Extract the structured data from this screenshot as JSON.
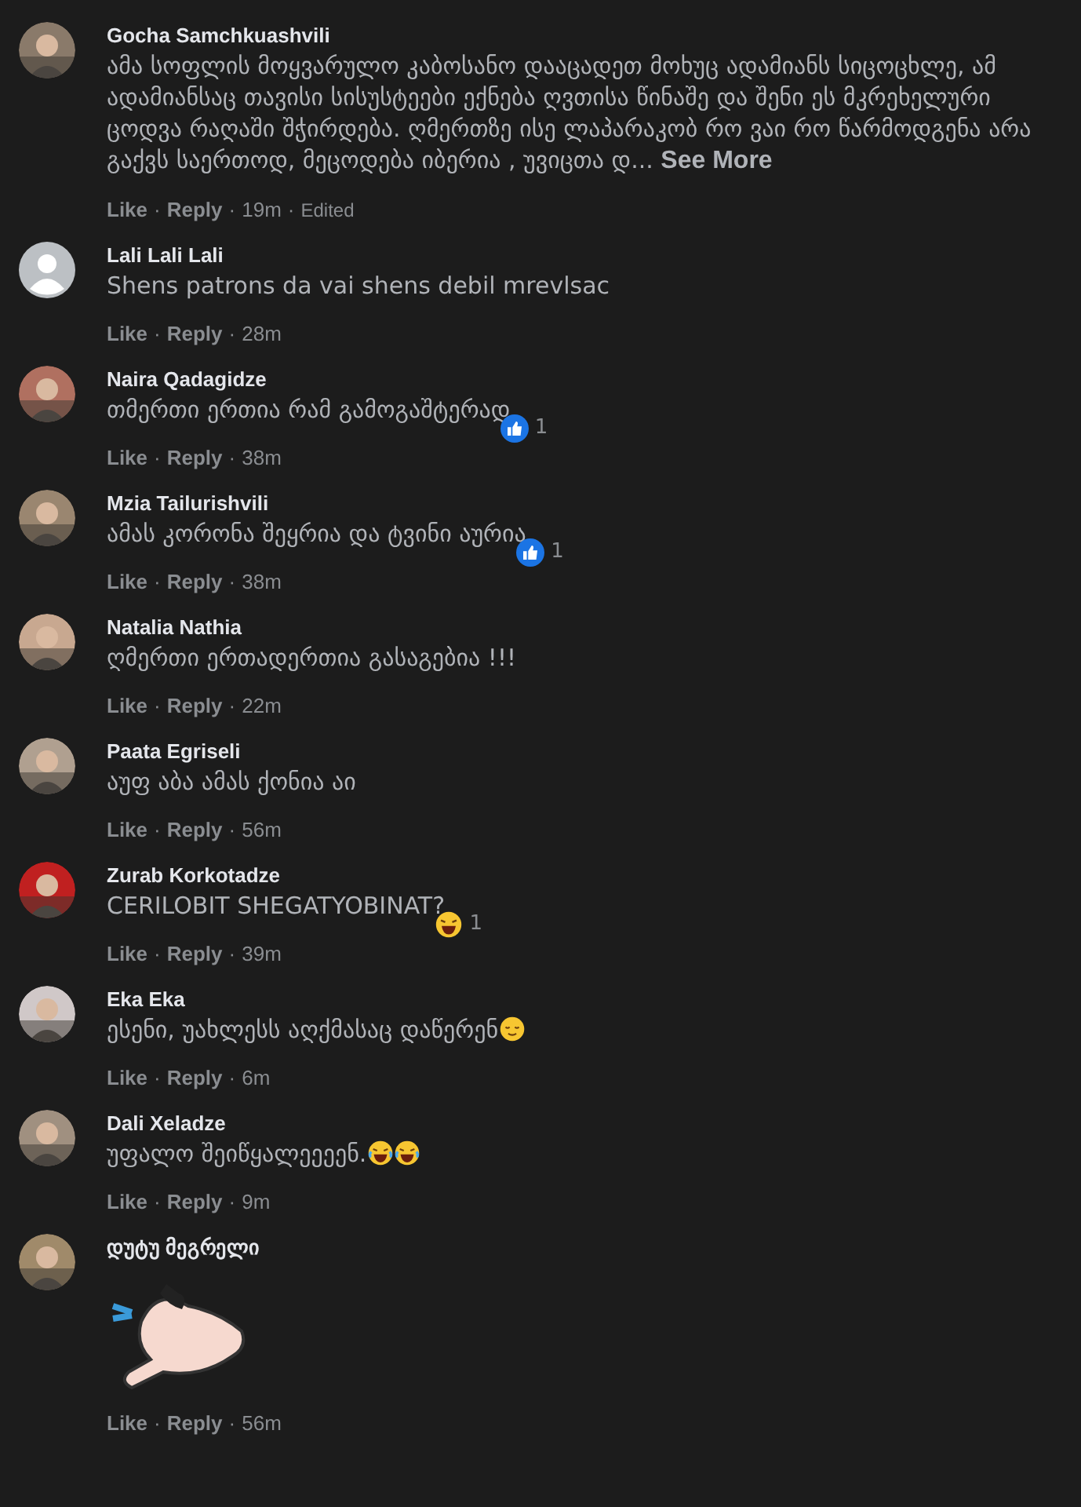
{
  "comments": [
    {
      "author": "Gocha Samchkuashvili",
      "avatar": {
        "kind": "picture"
      },
      "text": "ამა სოფლის მოყვარულო კაბოსანო დააცადეთ მოხუც ადამიანს სიცოცხლე, ამ ადამიანსაც თავისი სისუსტეები ექნება ღვთისა წინაშე და შენი ეს მკრეხელური ცოდვა რაღაში შჭირდება. ღმერთზე ისე ლაპარაკობ რო ვაი რო წარმოდგენა არა გაქვს საერთოდ, მეცოდება იბერია , უვიცთა დ...",
      "see_more": "See More",
      "actions": {
        "like": "Like",
        "separator": "·",
        "reply": "Reply",
        "time": "19m",
        "edited": "Edited"
      }
    },
    {
      "author": "Lali Lali Lali",
      "avatar": {
        "kind": "default"
      },
      "text": "Shens patrons da vai shens debil mrevlsac",
      "actions": {
        "like": "Like",
        "separator": "·",
        "reply": "Reply",
        "time": "28m"
      }
    },
    {
      "author": "Naira Qadagidze",
      "avatar": {
        "kind": "picture"
      },
      "text": "თმერთი ერთია რამ გამოგაშტერად",
      "reaction": {
        "kind": "like",
        "count": "1"
      },
      "actions": {
        "like": "Like",
        "separator": "·",
        "reply": "Reply",
        "time": "38m"
      }
    },
    {
      "author": "Mzia Tailurishvili",
      "avatar": {
        "kind": "picture"
      },
      "text": "ამას კორონა შეყრია და ტვინი აურია",
      "reaction": {
        "kind": "like",
        "count": "1"
      },
      "actions": {
        "like": "Like",
        "separator": "·",
        "reply": "Reply",
        "time": "38m"
      }
    },
    {
      "author": "Natalia Nathia",
      "avatar": {
        "kind": "picture"
      },
      "text": "ღმერთი ერთადერთია გასაგებია !!!",
      "actions": {
        "like": "Like",
        "separator": "·",
        "reply": "Reply",
        "time": "22m"
      }
    },
    {
      "author": "Paata Egriseli",
      "avatar": {
        "kind": "picture"
      },
      "text": "აუფ აბა ამას ქონია აი",
      "actions": {
        "like": "Like",
        "separator": "·",
        "reply": "Reply",
        "time": "56m"
      }
    },
    {
      "author": "Zurab Korkotadze",
      "avatar": {
        "kind": "picture"
      },
      "text": "CERILOBIT SHEGATYOBINAT?",
      "reaction": {
        "kind": "haha",
        "count": "1"
      },
      "actions": {
        "like": "Like",
        "separator": "·",
        "reply": "Reply",
        "time": "39m"
      }
    },
    {
      "author": "Eka Eka",
      "avatar": {
        "kind": "picture"
      },
      "text": "ესენი, უახლესს აღქმასაც დაწერენ",
      "emojis": [
        {
          "kind": "relieved"
        }
      ],
      "actions": {
        "like": "Like",
        "separator": "·",
        "reply": "Reply",
        "time": "6m"
      }
    },
    {
      "author": "Dali Xeladze",
      "avatar": {
        "kind": "picture"
      },
      "text": "უფალო შეიწყალეეეენ.",
      "emojis": [
        {
          "kind": "crying-laughing"
        },
        {
          "kind": "crying-laughing"
        }
      ],
      "actions": {
        "like": "Like",
        "separator": "·",
        "reply": "Reply",
        "time": "9m"
      }
    },
    {
      "author": "დუტუ მეგრელი",
      "avatar": {
        "kind": "picture"
      },
      "sticker": {
        "kind": "picture"
      },
      "actions": {
        "like": "Like",
        "separator": "·",
        "reply": "Reply",
        "time": "56m"
      }
    }
  ]
}
